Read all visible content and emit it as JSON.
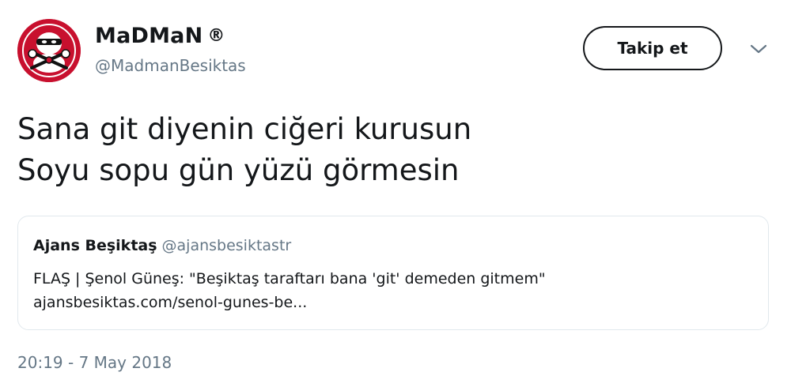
{
  "author": {
    "display_name": "MaDMaN",
    "badge": "®",
    "handle": "@MadmanBesiktas",
    "avatar_icon": "ninja-mascot-icon",
    "avatar_color": "#c8102e"
  },
  "actions": {
    "follow_label": "Takip et",
    "more_icon": "chevron-down-icon"
  },
  "tweet": {
    "lines": [
      "Sana git diyenin ciğeri kurusun",
      "Soyu sopu gün yüzü görmesin"
    ]
  },
  "quoted": {
    "name": "Ajans Beşiktaş",
    "handle": "@ajansbesiktastr",
    "text": "FLAŞ | Şenol Güneş: \"Beşiktaş taraftarı bana 'git' demeden gitmem\"",
    "link": "ajansbesiktas.com/senol-gunes-be..."
  },
  "timestamp": "20:19 - 7 May 2018",
  "colors": {
    "text": "#14171a",
    "secondary": "#657786",
    "border": "#e1e8ed"
  }
}
